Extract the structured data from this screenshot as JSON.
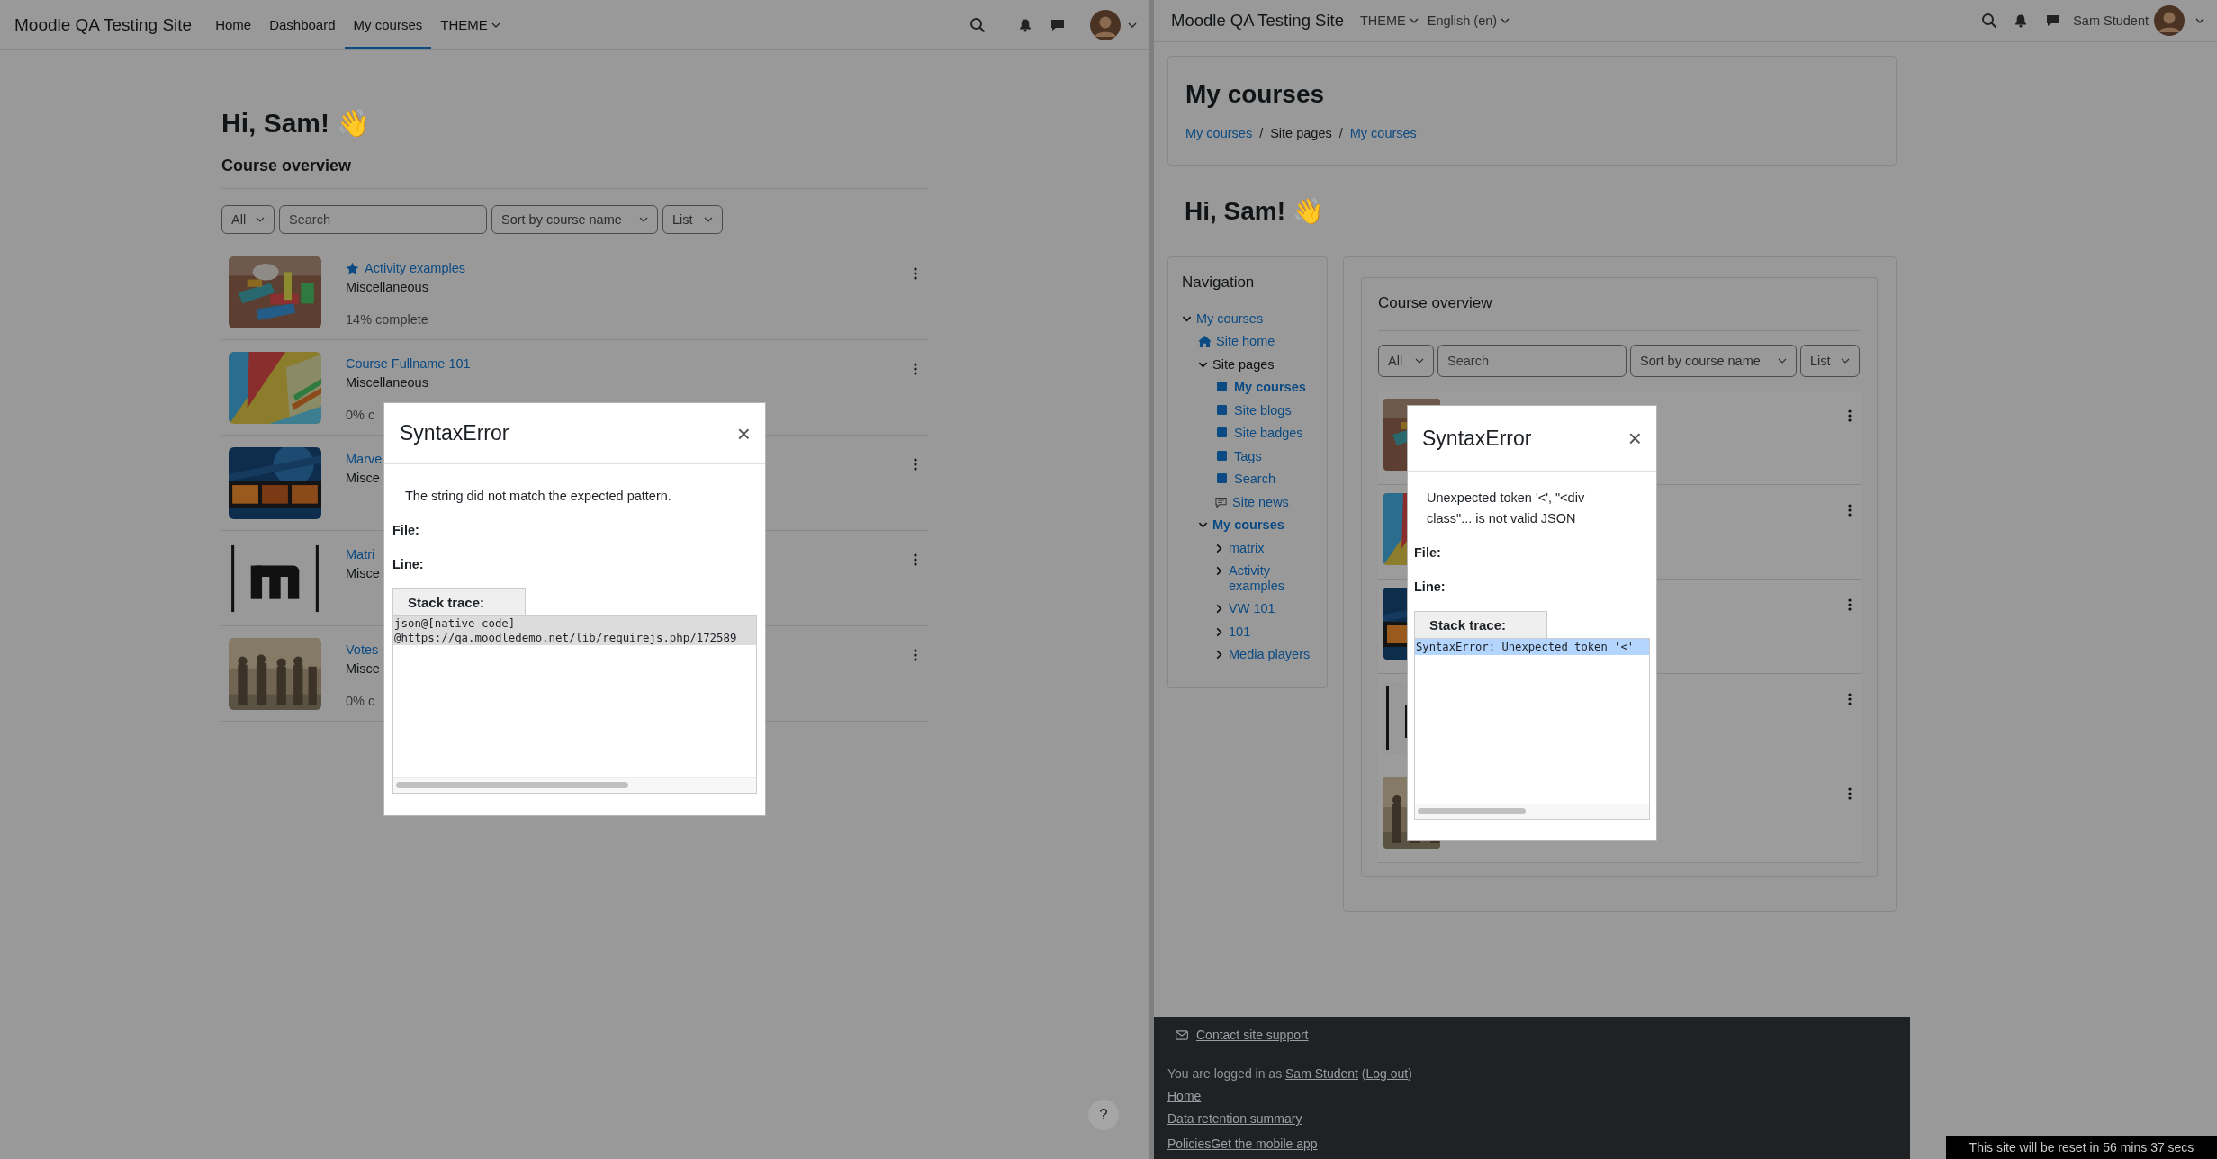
{
  "left_window": {
    "navbar": {
      "brand": "Moodle QA Testing Site",
      "items": [
        {
          "label": "Home",
          "selected": false,
          "dropdown": false
        },
        {
          "label": "Dashboard",
          "selected": false,
          "dropdown": false
        },
        {
          "label": "My courses",
          "selected": true,
          "dropdown": false
        },
        {
          "label": "THEME",
          "selected": false,
          "dropdown": true
        }
      ]
    },
    "greeting": "Hi, Sam! 👋",
    "course_overview": {
      "title": "Course overview",
      "filters": {
        "grouping": "All",
        "search_placeholder": "Search",
        "sort": "Sort by course name",
        "view": "List"
      },
      "courses": [
        {
          "title": "Activity examples",
          "starred": true,
          "category": "Miscellaneous",
          "progress": "14% complete"
        },
        {
          "title": "Course Fullname 101",
          "starred": false,
          "category": "Miscellaneous",
          "progress": "0% c"
        },
        {
          "title": "Marve",
          "starred": false,
          "category": "Misce"
        },
        {
          "title": "Matri",
          "starred": false,
          "category": "Misce"
        },
        {
          "title": "Votes",
          "starred": false,
          "category": "Misce",
          "progress": "0% c"
        }
      ]
    },
    "help_button": "?",
    "dialog": {
      "title": "SyntaxError",
      "close": "×",
      "message": "The string did not match the expected pattern.",
      "file_label": "File:",
      "line_label": "Line:",
      "stack_tab": "Stack trace:",
      "stack_lines": [
        "json@[native code]",
        "@https://qa.moodledemo.net/lib/requirejs.php/172589"
      ],
      "focused": false
    }
  },
  "right_window": {
    "navbar": {
      "brand": "Moodle QA Testing Site",
      "menus": [
        "THEME",
        "English (en)"
      ],
      "user_name": "Sam Student"
    },
    "page_header": {
      "title": "My courses",
      "separator": "/",
      "breadcrumb": [
        {
          "label": "My courses",
          "link": true
        },
        {
          "label": "Site pages",
          "link": false
        },
        {
          "label": "My courses",
          "link": true
        }
      ]
    },
    "greeting": "Hi, Sam! 👋",
    "navigation": {
      "title": "Navigation",
      "tree": [
        {
          "label": "My courses",
          "kind": "branch",
          "link": true,
          "active": false,
          "expanded": true,
          "children": [
            {
              "label": "Site home",
              "kind": "home",
              "link": true,
              "active": false
            },
            {
              "label": "Site pages",
              "kind": "branch",
              "link": false,
              "active": false,
              "expanded": true,
              "children": [
                {
                  "label": "My courses",
                  "kind": "page",
                  "link": true,
                  "active": true
                },
                {
                  "label": "Site blogs",
                  "kind": "page",
                  "link": true,
                  "active": false
                },
                {
                  "label": "Site badges",
                  "kind": "page",
                  "link": true,
                  "active": false
                },
                {
                  "label": "Tags",
                  "kind": "page",
                  "link": true,
                  "active": false
                },
                {
                  "label": "Search",
                  "kind": "page",
                  "link": true,
                  "active": false
                },
                {
                  "label": "Site news",
                  "kind": "news",
                  "link": true,
                  "active": false
                }
              ]
            },
            {
              "label": "My courses",
              "kind": "branch",
              "link": true,
              "active": true,
              "expanded": true,
              "children": [
                {
                  "label": "matrix",
                  "kind": "branch",
                  "link": true,
                  "active": false,
                  "expanded": false
                },
                {
                  "label": "Activity examples",
                  "kind": "branch",
                  "link": true,
                  "active": false,
                  "expanded": false
                },
                {
                  "label": "VW 101",
                  "kind": "branch",
                  "link": true,
                  "active": false,
                  "expanded": false
                },
                {
                  "label": "101",
                  "kind": "branch",
                  "link": true,
                  "active": false,
                  "expanded": false
                },
                {
                  "label": "Media players",
                  "kind": "branch",
                  "link": true,
                  "active": false,
                  "expanded": false
                }
              ]
            }
          ]
        }
      ]
    },
    "course_overview": {
      "title": "Course overview",
      "filters": {
        "grouping": "All",
        "search_placeholder": "Search",
        "sort": "Sort by course name",
        "view": "List"
      }
    },
    "dialog": {
      "title": "SyntaxError",
      "close": "×",
      "message": "Unexpected token '<', \"<div class\"... is not valid JSON",
      "file_label": "File:",
      "line_label": "Line:",
      "stack_tab": "Stack trace:",
      "stack_lines": [
        "SyntaxError: Unexpected token '<'"
      ],
      "focused": true
    },
    "footer": {
      "contact": "Contact site support",
      "login_line": [
        {
          "text": "You are logged in as ",
          "link": false
        },
        {
          "text": "Sam Student",
          "link": true
        },
        {
          "text": " (",
          "link": false
        },
        {
          "text": "Log out",
          "link": true
        },
        {
          "text": ")",
          "link": false
        }
      ],
      "links": [
        "Home",
        "Data retention summary"
      ],
      "last_links": [
        "Policies",
        "Get the mobile app"
      ]
    },
    "reset_notice": "This site will be reset in 56 mins 37 secs"
  }
}
